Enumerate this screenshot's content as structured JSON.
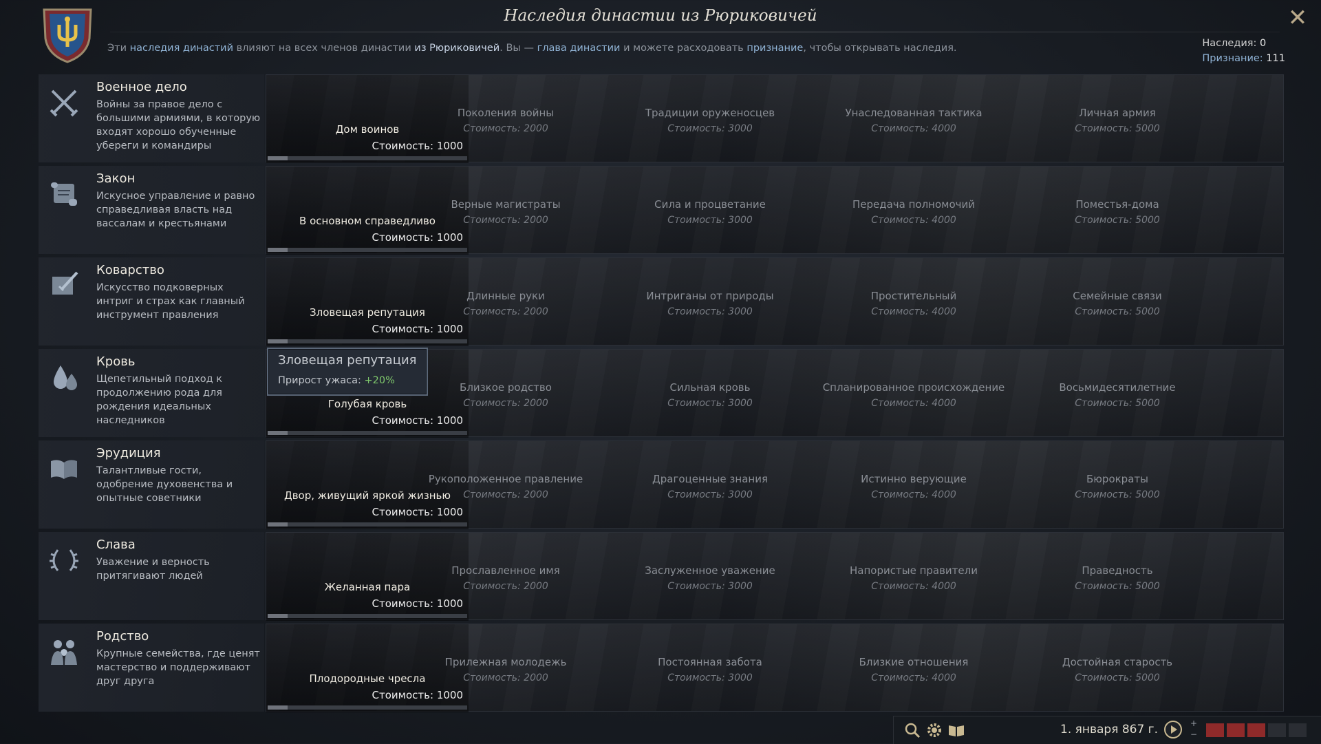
{
  "window": {
    "title": "Наследия династии из Рюриковичей",
    "close_icon": "close-icon"
  },
  "subtitle": {
    "p1": "Эти ",
    "hl1": "наследия династий",
    "p2": " влияют на всех членов династии ",
    "hl2": "из Рюриковичей",
    "p3": ". Вы — ",
    "hl3": "глава династии",
    "p4": " и можете расходовать ",
    "hl4": "признание",
    "p5": ", чтобы открывать наследия."
  },
  "stats": {
    "legacies_label": "Наследия:",
    "legacies_value": "0",
    "renown_label": "Признание:",
    "renown_value": "111"
  },
  "rows": [
    {
      "name": "Военное дело",
      "desc": "Войны за правое дело с большими армиями, в которую входят хорошо обученные убереги и командиры",
      "icon": "crossed-swords-icon",
      "first": {
        "name": "Дом воинов",
        "cost": "Стоимость: 1000"
      },
      "locked": [
        {
          "name": "Поколения войны",
          "cost": "Стоимость: 2000"
        },
        {
          "name": "Традиции оруженосцев",
          "cost": "Стоимость: 3000"
        },
        {
          "name": "Унаследованная тактика",
          "cost": "Стоимость: 4000"
        },
        {
          "name": "Личная армия",
          "cost": "Стоимость: 5000"
        }
      ]
    },
    {
      "name": "Закон",
      "desc": "Искусное управление и равно справедливая власть над вассалам и крестьянами",
      "icon": "scroll-icon",
      "first": {
        "name": "В основном справедливо",
        "cost": "Стоимость: 1000"
      },
      "locked": [
        {
          "name": "Верные магистраты",
          "cost": "Стоимость: 2000"
        },
        {
          "name": "Сила и процветание",
          "cost": "Стоимость: 3000"
        },
        {
          "name": "Передача полномочий",
          "cost": "Стоимость: 4000"
        },
        {
          "name": "Поместья-дома",
          "cost": "Стоимость: 5000"
        }
      ]
    },
    {
      "name": "Коварство",
      "desc": "Искусство подковерных интриг и страх как главный инструмент правления",
      "icon": "dagger-letter-icon",
      "first": {
        "name": "Зловещая репутация",
        "cost": "Стоимость: 1000"
      },
      "locked": [
        {
          "name": "Длинные руки",
          "cost": "Стоимость: 2000"
        },
        {
          "name": "Интриганы от природы",
          "cost": "Стоимость: 3000"
        },
        {
          "name": "Простительный",
          "cost": "Стоимость: 4000"
        },
        {
          "name": "Семейные связи",
          "cost": "Стоимость: 5000"
        }
      ]
    },
    {
      "name": "Кровь",
      "desc": "Щепетильный подход к продолжению рода для рождения идеальных наследников",
      "icon": "blood-drops-icon",
      "first": {
        "name": "Голубая кровь",
        "cost": "Стоимость: 1000"
      },
      "locked": [
        {
          "name": "Близкое родство",
          "cost": "Стоимость: 2000"
        },
        {
          "name": "Сильная кровь",
          "cost": "Стоимость: 3000"
        },
        {
          "name": "Спланированное происхождение",
          "cost": "Стоимость: 4000"
        },
        {
          "name": "Восьмидесятилетние",
          "cost": "Стоимость: 5000"
        }
      ]
    },
    {
      "name": "Эрудиция",
      "desc": "Талантливые гости, одобрение духовенства и опытные советники",
      "icon": "open-book-icon",
      "first": {
        "name": "Двор, живущий яркой жизнью",
        "cost": "Стоимость: 1000"
      },
      "locked": [
        {
          "name": "Рукоположенное правление",
          "cost": "Стоимость: 2000"
        },
        {
          "name": "Драгоценные знания",
          "cost": "Стоимость: 3000"
        },
        {
          "name": "Истинно верующие",
          "cost": "Стоимость: 4000"
        },
        {
          "name": "Бюрократы",
          "cost": "Стоимость: 5000"
        }
      ]
    },
    {
      "name": "Слава",
      "desc": "Уважение и верность притягивают людей",
      "icon": "laurel-wreath-icon",
      "first": {
        "name": "Желанная пара",
        "cost": "Стоимость: 1000"
      },
      "locked": [
        {
          "name": "Прославленное имя",
          "cost": "Стоимость: 2000"
        },
        {
          "name": "Заслуженное уважение",
          "cost": "Стоимость: 3000"
        },
        {
          "name": "Напористые правители",
          "cost": "Стоимость: 4000"
        },
        {
          "name": "Праведность",
          "cost": "Стоимость: 5000"
        }
      ]
    },
    {
      "name": "Родство",
      "desc": "Крупные семейства, где ценят мастерство и поддерживают друг друга",
      "icon": "family-icon",
      "first": {
        "name": "Плодородные чресла",
        "cost": "Стоимость: 1000"
      },
      "locked": [
        {
          "name": "Прилежная молодежь",
          "cost": "Стоимость: 2000"
        },
        {
          "name": "Постоянная забота",
          "cost": "Стоимость: 3000"
        },
        {
          "name": "Близкие отношения",
          "cost": "Стоимость: 4000"
        },
        {
          "name": "Достойная старость",
          "cost": "Стоимость: 5000"
        }
      ]
    }
  ],
  "progress": 0.1,
  "tooltip": {
    "title": "Зловещая репутация",
    "line_label": "Прирост ужаса: ",
    "line_value": "+20%"
  },
  "bottombar": {
    "date": "1. января 867 г.",
    "icons": [
      "search-icon",
      "gear-icon",
      "book-icon",
      "play-icon"
    ],
    "speed_plus": "+",
    "speed_minus": "−"
  },
  "colors": {
    "accent_blue": "#8fb2d4",
    "positive_green": "#7fc86c",
    "speed_red": "#8f2a2a"
  }
}
